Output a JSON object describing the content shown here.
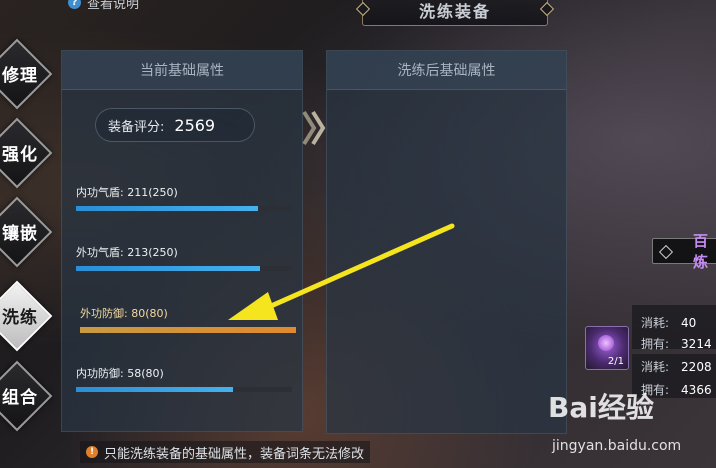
{
  "top_hint": {
    "label": "查看说明"
  },
  "title": "洗练装备",
  "side_tabs": [
    {
      "label": "修理",
      "active": false
    },
    {
      "label": "强化",
      "active": false
    },
    {
      "label": "镶嵌",
      "active": false
    },
    {
      "label": "洗练",
      "active": true
    },
    {
      "label": "组合",
      "active": false
    }
  ],
  "left_panel": {
    "header": "当前基础属性",
    "score": {
      "label": "装备评分:",
      "value": "2569"
    },
    "attributes": [
      {
        "label": "内功气盾: 211(250)",
        "progress": 0.844,
        "highlighted": false
      },
      {
        "label": "外功气盾: 213(250)",
        "progress": 0.852,
        "highlighted": false
      },
      {
        "label": "外功防御: 80(80)",
        "progress": 1.0,
        "highlighted": true
      },
      {
        "label": "内功防御: 58(80)",
        "progress": 0.725,
        "highlighted": false
      }
    ]
  },
  "right_panel": {
    "header": "洗练后基础属性"
  },
  "bottom_note": "只能洗练装备的基础属性，装备词条无法修改",
  "right_tag": {
    "label": "百炼"
  },
  "item": {
    "count": "2/1"
  },
  "costs": [
    {
      "label": "消耗:",
      "value": "40"
    },
    {
      "label": "拥有:",
      "value": "3214"
    },
    {
      "label": "消耗:",
      "value": "2208"
    },
    {
      "label": "拥有:",
      "value": "4366"
    }
  ],
  "watermark": {
    "text": "Bai经验",
    "sub": "jingyan.baidu.com"
  },
  "colors": {
    "bar_blue": "#2a8fd6",
    "bar_gold": "#e08a2e",
    "annotation_arrow": "#f5e51e"
  }
}
